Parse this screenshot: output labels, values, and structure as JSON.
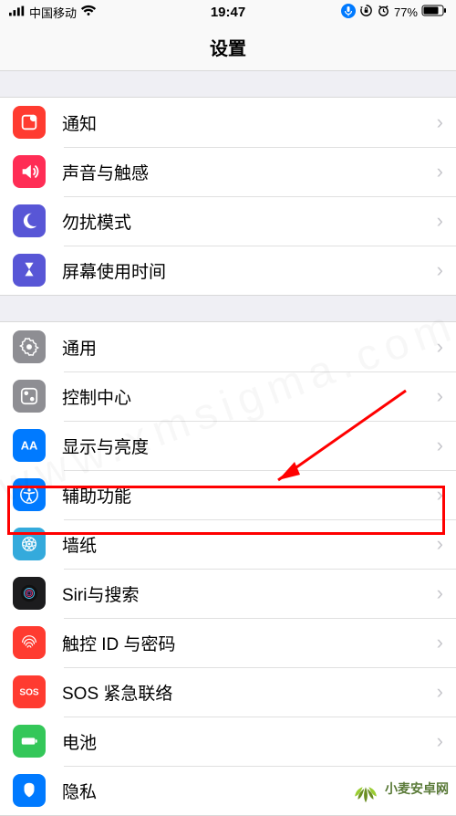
{
  "status": {
    "carrier": "中国移动",
    "time": "19:47",
    "battery_pct": "77%"
  },
  "header": {
    "title": "设置"
  },
  "group1": [
    {
      "id": "notifications",
      "label": "通知"
    },
    {
      "id": "sounds",
      "label": "声音与触感"
    },
    {
      "id": "dnd",
      "label": "勿扰模式"
    },
    {
      "id": "screentime",
      "label": "屏幕使用时间"
    }
  ],
  "group2": [
    {
      "id": "general",
      "label": "通用"
    },
    {
      "id": "controlcenter",
      "label": "控制中心"
    },
    {
      "id": "display",
      "label": "显示与亮度"
    },
    {
      "id": "accessibility",
      "label": "辅助功能",
      "highlighted": true
    },
    {
      "id": "wallpaper",
      "label": "墙纸"
    },
    {
      "id": "siri",
      "label": "Siri与搜索"
    },
    {
      "id": "touchid",
      "label": "触控 ID 与密码"
    },
    {
      "id": "sos",
      "label": "SOS 紧急联络"
    },
    {
      "id": "battery",
      "label": "电池"
    },
    {
      "id": "privacy",
      "label": "隐私"
    }
  ],
  "watermark_center": "www.xmsigma.com",
  "watermark_brand": "小麦安卓网"
}
